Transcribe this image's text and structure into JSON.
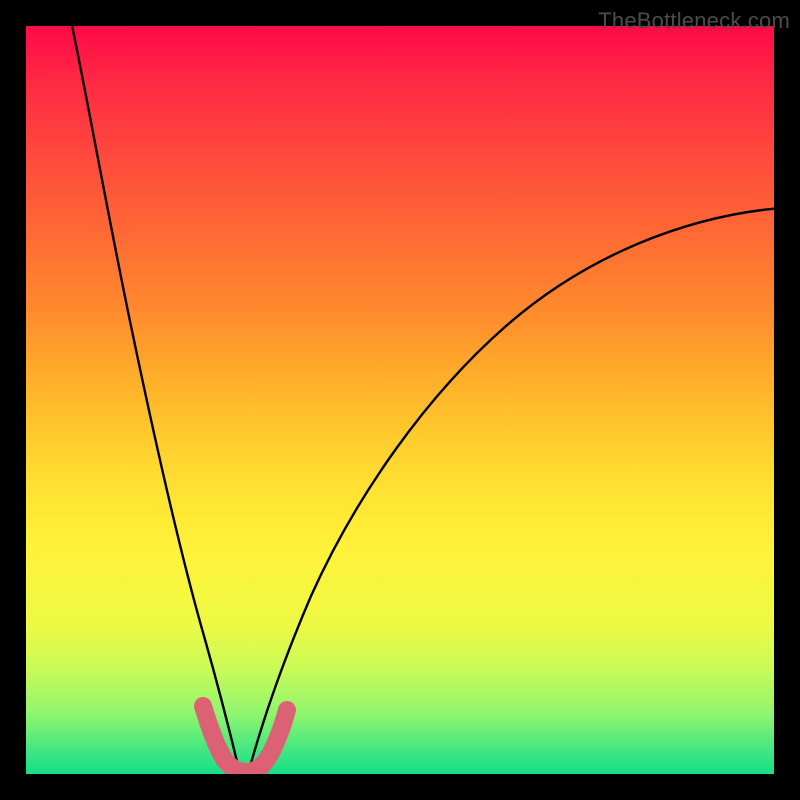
{
  "watermark": "TheBottleneck.com",
  "chart_data": {
    "type": "line",
    "title": "",
    "xlabel": "",
    "ylabel": "",
    "xlim": [
      0,
      100
    ],
    "ylim": [
      0,
      100
    ],
    "series": [
      {
        "name": "left-branch",
        "x": [
          6,
          8,
          10,
          12,
          14,
          16,
          18,
          20,
          22,
          24,
          26,
          27,
          28
        ],
        "values": [
          100,
          90,
          80,
          70,
          59,
          48,
          38,
          28,
          19,
          11,
          5,
          2,
          0
        ]
      },
      {
        "name": "right-branch",
        "x": [
          30,
          32,
          36,
          40,
          46,
          52,
          60,
          68,
          76,
          84,
          92,
          100
        ],
        "values": [
          0,
          4,
          12,
          20,
          30,
          39,
          49,
          57,
          63,
          68,
          72,
          75
        ]
      }
    ],
    "highlight": {
      "name": "bottleneck-region",
      "x": [
        23.5,
        24.5,
        25.5,
        26.5,
        27.5,
        28.5,
        29.5,
        30.5,
        31.5,
        32.5,
        33.5
      ],
      "values": [
        8.5,
        6,
        4,
        2.3,
        1.2,
        0.8,
        1.2,
        2.2,
        3.8,
        5.6,
        7.8
      ],
      "color": "#e06070"
    },
    "background_gradient": {
      "top": "#ff0a47",
      "mid": "#ffe232",
      "bottom": "#14df86"
    }
  }
}
